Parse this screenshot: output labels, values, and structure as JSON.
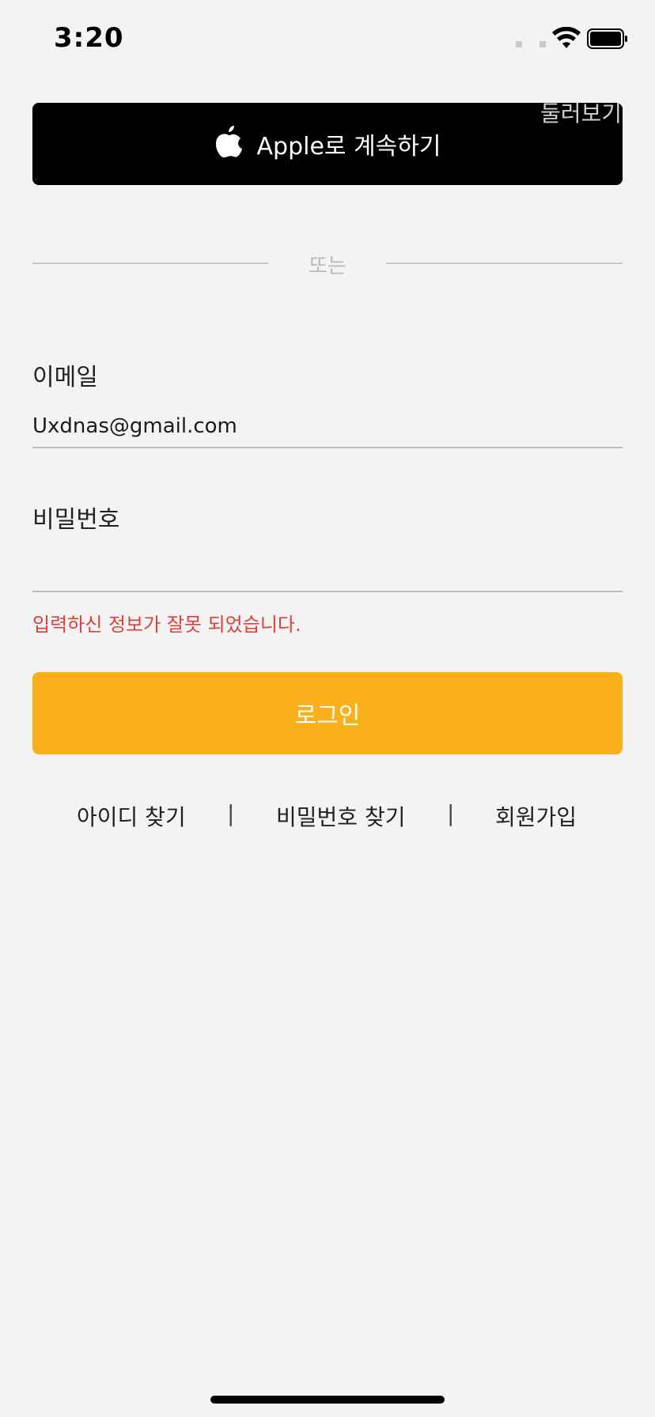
{
  "status_bar": {
    "time": "3:20"
  },
  "apple_button": {
    "label": "Apple로 계속하기",
    "icon": "apple-logo-icon"
  },
  "browse_label": "둘러보기",
  "divider_label": "또는",
  "email": {
    "label": "이메일",
    "value": "Uxdnas@gmail.com"
  },
  "password": {
    "label": "비밀번호",
    "value": ""
  },
  "error_message": "입력하신 정보가 잘못 되었습니다.",
  "login_button": {
    "label": "로그인"
  },
  "links": {
    "find_id": "아이디 찾기",
    "separator": "|",
    "find_password": "비밀번호 찾기",
    "signup": "회원가입"
  },
  "colors": {
    "accent": "#FBB01B",
    "error": "#E0403A",
    "background": "#F3F3F3"
  }
}
